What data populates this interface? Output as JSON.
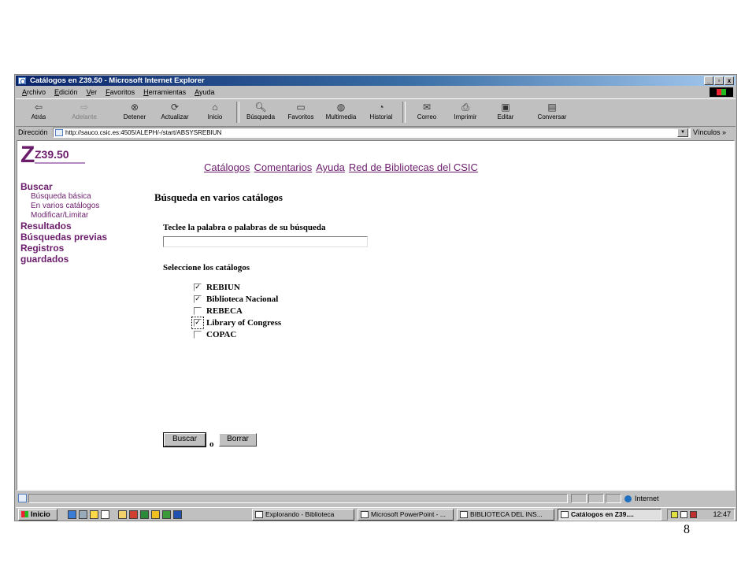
{
  "window": {
    "title": "Catálogos en Z39.50 - Microsoft Internet Explorer",
    "controls": [
      "_",
      "▫",
      "x"
    ]
  },
  "menu": [
    "Archivo",
    "Edición",
    "Ver",
    "Favoritos",
    "Herramientas",
    "Ayuda"
  ],
  "toolbar": {
    "back": "Atrás",
    "forward": "Adelante",
    "stop": "Detener",
    "refresh": "Actualizar",
    "home": "Inicio",
    "search": "Búsqueda",
    "favorites": "Favoritos",
    "multimedia": "Multimedia",
    "history": "Historial",
    "mail": "Correo",
    "print": "Imprimir",
    "edit": "Editar",
    "discuss": "Conversar"
  },
  "address": {
    "label": "Dirección",
    "url": "http://sauco.csic.es:4505/ALEPH/-/start/ABSYSREBIUN",
    "links": "Vínculos »"
  },
  "page": {
    "logo": "Z39.50",
    "topnav": [
      "Catálogos",
      "Comentarios",
      "Ayuda",
      "Red de Bibliotecas del CSIC"
    ],
    "sidebar": {
      "buscar": "Buscar",
      "basic": "Búsqueda básica",
      "multi": "En varios catálogos",
      "modify": "Modificar/Limitar",
      "results": "Resultados",
      "previous": "Búsquedas previas",
      "saved1": "Registros",
      "saved2": "guardados"
    },
    "heading": "Búsqueda en varios catálogos",
    "search_label": "Teclee la palabra o palabras de su búsqueda",
    "search_value": "",
    "catalogs_label": "Seleccione los catálogos",
    "catalogs": [
      {
        "name": "REBIUN",
        "checked": true
      },
      {
        "name": "Biblioteca Nacional",
        "checked": true
      },
      {
        "name": "REBECA",
        "checked": false
      },
      {
        "name": "Library of Congress",
        "checked": true
      },
      {
        "name": "COPAC",
        "checked": false
      }
    ],
    "search_button": "Buscar",
    "or_text": "o",
    "clear_button": "Borrar"
  },
  "status": {
    "zone": "Internet"
  },
  "taskbar": {
    "start": "Inicio",
    "tasks": [
      "Explorando - Biblioteca",
      "Microsoft PowerPoint - ...",
      "BIBLIOTECA DEL INS...",
      "Catálogos en Z39...."
    ],
    "clock": "12:47"
  },
  "slide_number": "8",
  "colors": {
    "titlebar": "#0a246a",
    "link_purple": "#6b1d6b",
    "chrome": "#c0c0c0"
  }
}
